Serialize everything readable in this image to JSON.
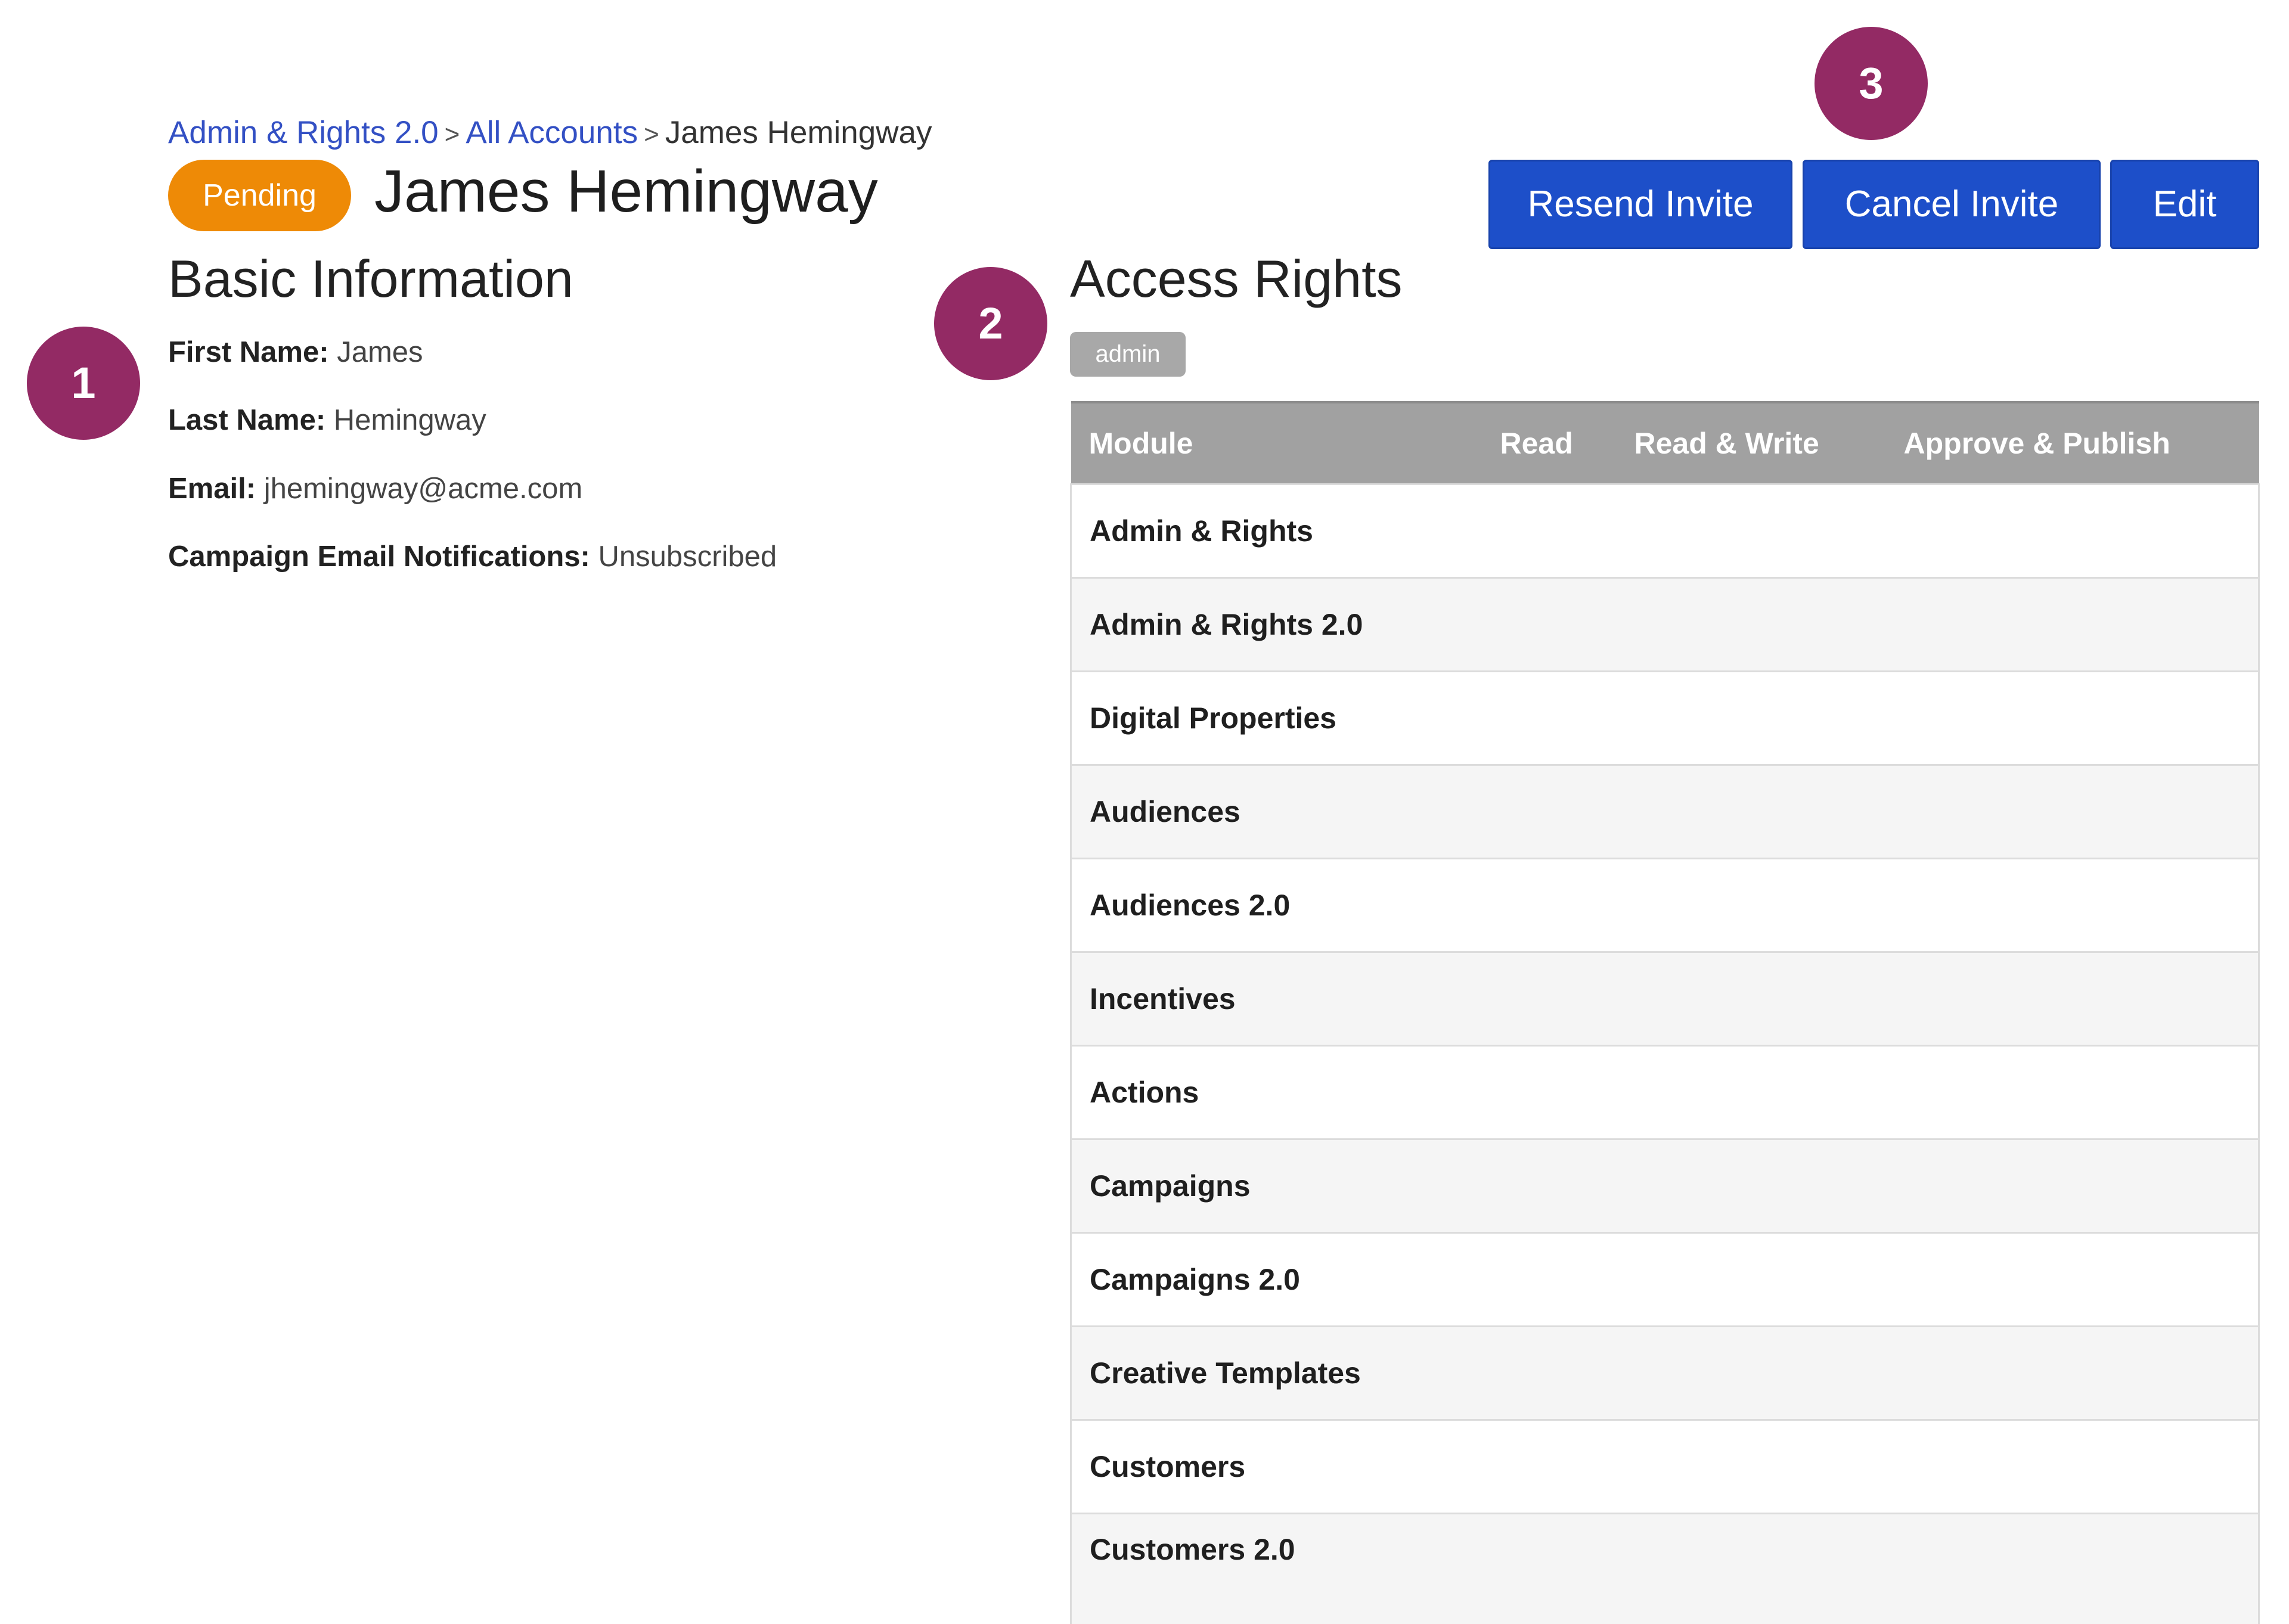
{
  "breadcrumb": {
    "items": [
      "Admin & Rights 2.0",
      "All Accounts"
    ],
    "current": "James Hemingway",
    "separator": ">"
  },
  "header": {
    "status": "Pending",
    "title": "James Hemingway"
  },
  "actions": {
    "resend": "Resend Invite",
    "cancel": "Cancel Invite",
    "edit": "Edit"
  },
  "basic_info": {
    "heading": "Basic Information",
    "fields": [
      {
        "label": "First Name:",
        "value": "James"
      },
      {
        "label": "Last Name:",
        "value": "Hemingway"
      },
      {
        "label": "Email:",
        "value": "jhemingway@acme.com"
      },
      {
        "label": "Campaign Email Notifications:",
        "value": "Unsubscribed"
      }
    ]
  },
  "access_rights": {
    "heading": "Access Rights",
    "tag": "admin",
    "columns": [
      "Module",
      "Read",
      "Read & Write",
      "Approve & Publish"
    ],
    "rows": [
      "Admin & Rights",
      "Admin & Rights 2.0",
      "Digital Properties",
      "Audiences",
      "Audiences 2.0",
      "Incentives",
      "Actions",
      "Campaigns",
      "Campaigns 2.0",
      "Creative Templates",
      "Customers",
      "Customers 2.0"
    ]
  },
  "markers": [
    "1",
    "2",
    "3"
  ],
  "colors": {
    "link": "#3350c4",
    "status_pending": "#ee8a06",
    "button": "#1d4fc9",
    "marker": "#932a64",
    "table_header": "#a1a1a1",
    "tag": "#a8a8a8"
  }
}
